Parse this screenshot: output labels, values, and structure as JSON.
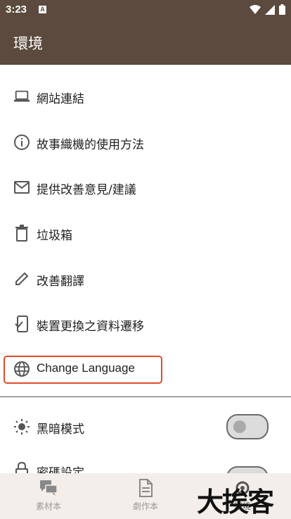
{
  "status_bar": {
    "time": "3:23",
    "notification_badge": "A",
    "icons": [
      "wifi-icon",
      "signal-icon",
      "battery-icon"
    ]
  },
  "app_bar": {
    "title": "環境"
  },
  "menu": {
    "items": [
      {
        "label": "網站連結",
        "icon": "laptop-icon"
      },
      {
        "label": "故事織機的使用方法",
        "icon": "info-icon"
      },
      {
        "label": "提供改善意見/建議",
        "icon": "mail-icon"
      },
      {
        "label": "垃圾箱",
        "icon": "trash-icon"
      },
      {
        "label": "改善翻譯",
        "icon": "pencil-icon"
      },
      {
        "label": "裝置更換之資料遷移",
        "icon": "phone-transfer-icon"
      },
      {
        "label": "Change Language",
        "icon": "globe-icon"
      }
    ],
    "settings": [
      {
        "label": "黑暗模式",
        "icon": "sun-icon",
        "toggle_on": false
      },
      {
        "label": "密碼設定",
        "icon": "lock-icon",
        "toggle_on": false
      }
    ]
  },
  "bottom_nav": {
    "items": [
      {
        "label": "素材本",
        "icon": "chat-icon"
      },
      {
        "label": "劇作本",
        "icon": "document-icon"
      },
      {
        "label": "環境",
        "icon": "settings-icon"
      }
    ]
  },
  "watermark": {
    "text": "大挨客"
  },
  "colors": {
    "app_bar": "#5b4a3d",
    "highlight": "#e04b2b",
    "nav_bg": "#f3eee9"
  }
}
